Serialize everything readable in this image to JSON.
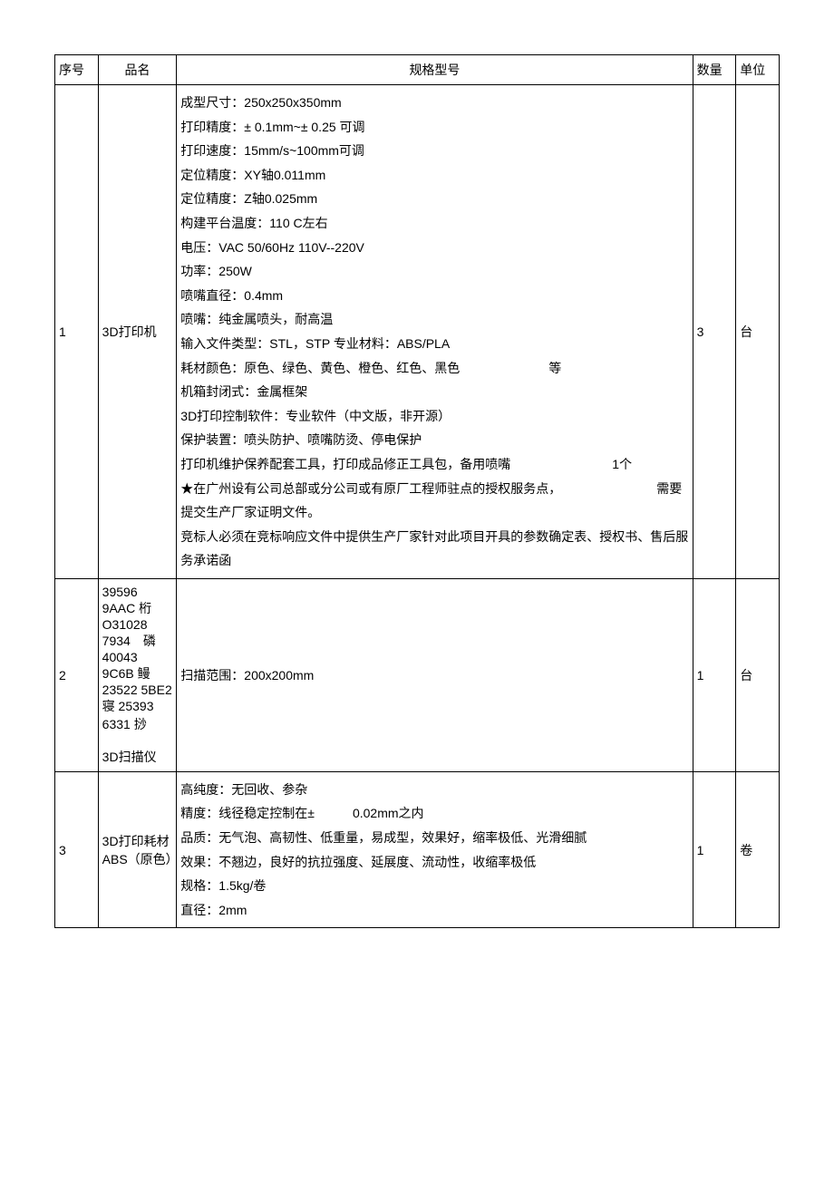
{
  "headers": {
    "seq": "序号",
    "name": "品名",
    "spec": "规格型号",
    "qty": "数量",
    "unit": "单位"
  },
  "rows": [
    {
      "seq": "1",
      "name": "3D打印机",
      "spec_lines": [
        "成型尺寸：250x250x350mm",
        "打印精度：± 0.1mm~± 0.25 可调",
        "打印速度：15mm/s~100mm可调",
        "定位精度：XY轴0.011mm",
        "定位精度：Z轴0.025mm",
        "构建平台温度：110 C左右",
        "电压：VAC 50/60Hz 110V--220V",
        "功率：250W",
        "喷嘴直径：0.4mm",
        "喷嘴：纯金属喷头，耐高温",
        "输入文件类型：STL，STP 专业材料：ABS/PLA",
        "耗材颜色：原色、绿色、黄色、橙色、红色、黑色　　　　　　　等",
        "机箱封闭式：金属框架",
        "3D打印控制软件：专业软件（中文版，非开源）",
        "保护装置：喷头防护、喷嘴防烫、停电保护",
        "打印机维护保养配套工具，打印成品修正工具包，备用喷嘴　　　　　　　　1个",
        "★在广州设有公司总部或分公司或有原厂工程师驻点的授权服务点，　　　　　　　　需要提交生产厂家证明文件。",
        "竞标人必须在竞标响应文件中提供生产厂家针对此项目开具的参数确定表、授权书、售后服务承诺函"
      ],
      "qty": "3",
      "unit": "台"
    },
    {
      "seq": "2",
      "name": "39596 9AAC 桁 O31028 7934　磷 40043 9C6B 鳗 23522 5BE2 寝 25393 6331 挱\n\n3D扫描仪",
      "spec_lines": [
        "扫描范围：200x200mm"
      ],
      "qty": "1",
      "unit": "台"
    },
    {
      "seq": "3",
      "name": "3D打印耗材ABS（原色）",
      "spec_lines": [
        "高纯度：无回收、参杂",
        "精度：线径稳定控制在±　　　0.02mm之内",
        "品质：无气泡、高韧性、低重量，易成型，效果好，缩率极低、光滑细腻",
        "效果：不翘边，良好的抗拉强度、延展度、流动性，收缩率极低",
        "规格：1.5kg/卷",
        "直径：2mm"
      ],
      "qty": "1",
      "unit": "卷"
    }
  ]
}
